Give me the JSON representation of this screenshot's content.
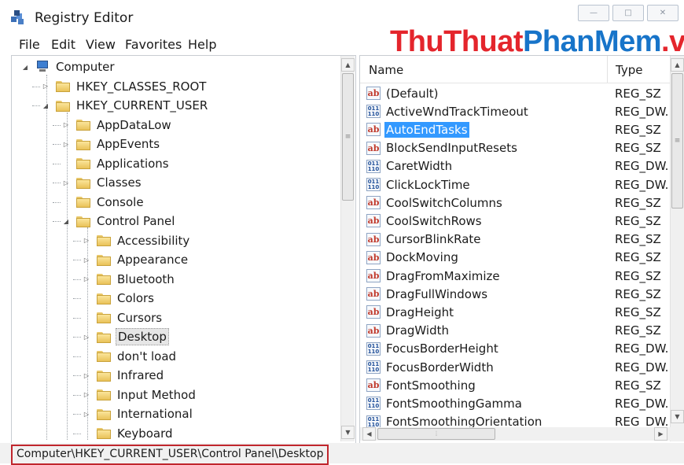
{
  "window": {
    "title": "Registry Editor",
    "controls": {
      "minimize": "—",
      "maximize": "□",
      "close": "✕"
    }
  },
  "watermark": {
    "part1": "ThuThuat",
    "part2": "PhanMem",
    "part3": ".vn"
  },
  "menu": [
    "File",
    "Edit",
    "View",
    "Favorites",
    "Help"
  ],
  "tree": [
    {
      "label": "Computer",
      "level": 0,
      "expander": "◢",
      "icon": "computer-icon"
    },
    {
      "label": "HKEY_CLASSES_ROOT",
      "level": 1,
      "expander": "▷",
      "icon": "folder-icon"
    },
    {
      "label": "HKEY_CURRENT_USER",
      "level": 1,
      "expander": "◢",
      "icon": "folder-icon"
    },
    {
      "label": "AppDataLow",
      "level": 2,
      "expander": "▷",
      "icon": "folder-icon"
    },
    {
      "label": "AppEvents",
      "level": 2,
      "expander": "▷",
      "icon": "folder-icon"
    },
    {
      "label": "Applications",
      "level": 2,
      "expander": "",
      "icon": "folder-icon"
    },
    {
      "label": "Classes",
      "level": 2,
      "expander": "▷",
      "icon": "folder-icon"
    },
    {
      "label": "Console",
      "level": 2,
      "expander": "",
      "icon": "folder-icon"
    },
    {
      "label": "Control Panel",
      "level": 2,
      "expander": "◢",
      "icon": "folder-icon"
    },
    {
      "label": "Accessibility",
      "level": 3,
      "expander": "▷",
      "icon": "folder-icon"
    },
    {
      "label": "Appearance",
      "level": 3,
      "expander": "▷",
      "icon": "folder-icon"
    },
    {
      "label": "Bluetooth",
      "level": 3,
      "expander": "▷",
      "icon": "folder-icon"
    },
    {
      "label": "Colors",
      "level": 3,
      "expander": "",
      "icon": "folder-icon"
    },
    {
      "label": "Cursors",
      "level": 3,
      "expander": "",
      "icon": "folder-icon"
    },
    {
      "label": "Desktop",
      "level": 3,
      "expander": "▷",
      "icon": "folder-icon",
      "selected": true
    },
    {
      "label": "don't load",
      "level": 3,
      "expander": "",
      "icon": "folder-icon"
    },
    {
      "label": "Infrared",
      "level": 3,
      "expander": "▷",
      "icon": "folder-icon"
    },
    {
      "label": "Input Method",
      "level": 3,
      "expander": "▷",
      "icon": "folder-icon"
    },
    {
      "label": "International",
      "level": 3,
      "expander": "▷",
      "icon": "folder-icon"
    },
    {
      "label": "Keyboard",
      "level": 3,
      "expander": "",
      "icon": "folder-icon"
    }
  ],
  "list": {
    "columns": {
      "name": "Name",
      "type": "Type"
    },
    "rows": [
      {
        "name": "(Default)",
        "type": "REG_SZ",
        "icon": "ab"
      },
      {
        "name": "ActiveWndTrackTimeout",
        "type": "REG_DW...",
        "icon": "dw"
      },
      {
        "name": "AutoEndTasks",
        "type": "REG_SZ",
        "icon": "ab",
        "selected": true
      },
      {
        "name": "BlockSendInputResets",
        "type": "REG_SZ",
        "icon": "ab"
      },
      {
        "name": "CaretWidth",
        "type": "REG_DW...",
        "icon": "dw"
      },
      {
        "name": "ClickLockTime",
        "type": "REG_DW...",
        "icon": "dw"
      },
      {
        "name": "CoolSwitchColumns",
        "type": "REG_SZ",
        "icon": "ab"
      },
      {
        "name": "CoolSwitchRows",
        "type": "REG_SZ",
        "icon": "ab"
      },
      {
        "name": "CursorBlinkRate",
        "type": "REG_SZ",
        "icon": "ab"
      },
      {
        "name": "DockMoving",
        "type": "REG_SZ",
        "icon": "ab"
      },
      {
        "name": "DragFromMaximize",
        "type": "REG_SZ",
        "icon": "ab"
      },
      {
        "name": "DragFullWindows",
        "type": "REG_SZ",
        "icon": "ab"
      },
      {
        "name": "DragHeight",
        "type": "REG_SZ",
        "icon": "ab"
      },
      {
        "name": "DragWidth",
        "type": "REG_SZ",
        "icon": "ab"
      },
      {
        "name": "FocusBorderHeight",
        "type": "REG_DW...",
        "icon": "dw"
      },
      {
        "name": "FocusBorderWidth",
        "type": "REG_DW...",
        "icon": "dw"
      },
      {
        "name": "FontSmoothing",
        "type": "REG_SZ",
        "icon": "ab"
      },
      {
        "name": "FontSmoothingGamma",
        "type": "REG_DW...",
        "icon": "dw"
      },
      {
        "name": "FontSmoothingOrientation",
        "type": "REG_DW...",
        "icon": "dw"
      }
    ]
  },
  "icon_glyphs": {
    "ab": "ab",
    "dw": "011 110"
  },
  "status": {
    "path": "Computer\\HKEY_CURRENT_USER\\Control Panel\\Desktop"
  },
  "colors": {
    "selection": "#3399ff",
    "highlight_border": "#c0262d",
    "watermark_red": "#e4252c",
    "watermark_blue": "#1774c9"
  }
}
